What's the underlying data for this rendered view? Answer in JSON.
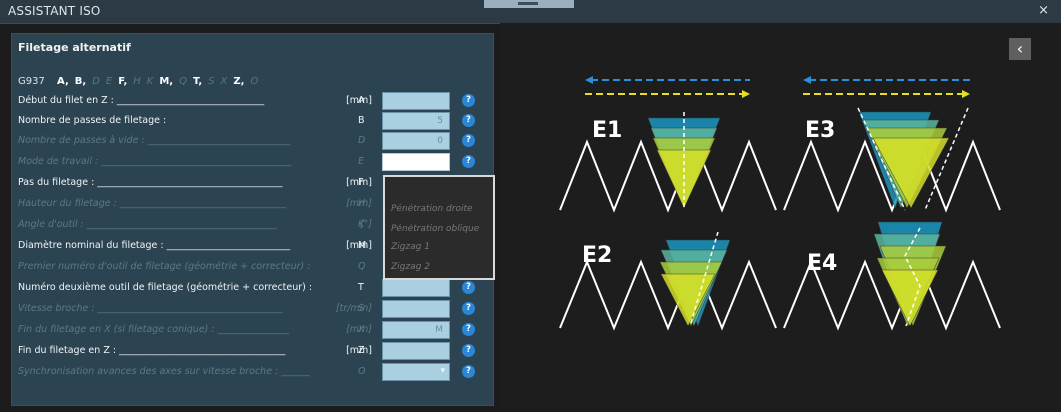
{
  "window": {
    "title": "ASSISTANT ISO",
    "close_icon": "×"
  },
  "panel": {
    "title": "Filetage alternatif",
    "gcode": {
      "prefix": "G937",
      "letters": [
        {
          "text": "A,",
          "active": true
        },
        {
          "text": "B,",
          "active": true
        },
        {
          "text": "D",
          "active": false
        },
        {
          "text": "E",
          "active": false
        },
        {
          "text": "F,",
          "active": true
        },
        {
          "text": "H",
          "active": false
        },
        {
          "text": "K",
          "active": false
        },
        {
          "text": "M,",
          "active": true
        },
        {
          "text": "Q",
          "active": false
        },
        {
          "text": "T,",
          "active": true
        },
        {
          "text": "S",
          "active": false
        },
        {
          "text": "X",
          "active": false
        },
        {
          "text": "Z,",
          "active": true
        },
        {
          "text": "O",
          "active": false
        }
      ]
    },
    "rows": [
      {
        "label": "Début du filet en Z : _______________________________",
        "unit": "[mm]",
        "letter": "A",
        "value": "",
        "active": true,
        "field": "blue"
      },
      {
        "label": "Nombre de passes de filetage :",
        "unit": "",
        "letter": "B",
        "value": "5",
        "active": true,
        "field": "blue"
      },
      {
        "label": "Nombre de passes à vide : ______________________________",
        "unit": "",
        "letter": "D",
        "value": "0",
        "active": false,
        "field": "blue"
      },
      {
        "label": "Mode de travail : ________________________________________",
        "unit": "",
        "letter": "E",
        "value": "",
        "active": false,
        "field": "white"
      },
      {
        "label": "Pas du filetage : _______________________________________",
        "unit": "[mm]",
        "letter": "F",
        "value": "",
        "active": true,
        "field": "none"
      },
      {
        "label": "Hauteur du filetage : ___________________________________",
        "unit": "[mm]",
        "letter": "H",
        "value": "",
        "active": false,
        "field": "none"
      },
      {
        "label": "Angle d'outil : ________________________________________",
        "unit": "[°]",
        "letter": "K",
        "value": "",
        "active": false,
        "field": "none"
      },
      {
        "label": "Diamètre nominal du filetage : __________________________",
        "unit": "[mm]",
        "letter": "M",
        "value": "",
        "active": true,
        "field": "none"
      },
      {
        "label": "Premier numéro d'outil de filetage (géométrie + correcteur) :",
        "unit": "",
        "letter": "Q",
        "value": "",
        "active": false,
        "field": "none"
      },
      {
        "label": "Numéro deuxième outil de filetage (géométrie + correcteur) :",
        "unit": "",
        "letter": "T",
        "value": "",
        "active": true,
        "field": "blue"
      },
      {
        "label": "Vitesse broche : _______________________________________",
        "unit": "[tr/min]",
        "letter": "S",
        "value": "",
        "active": false,
        "field": "blue"
      },
      {
        "label": "Fin du filetage en X (si filetage conique) : _______________",
        "unit": "[mm]",
        "letter": "X",
        "value": "M",
        "active": false,
        "field": "blue"
      },
      {
        "label": "Fin du filetage en Z : ___________________________________",
        "unit": "[mm]",
        "letter": "Z",
        "value": "",
        "active": true,
        "field": "blue"
      },
      {
        "label": "Synchronisation avances des axes sur vitesse broche : ______",
        "unit": "",
        "letter": "O",
        "value": "",
        "active": false,
        "field": "dropdown"
      }
    ],
    "help_icon": "?"
  },
  "popup": {
    "options": [
      "Pénétration droite",
      "Pénétration oblique",
      "Zigzag 1",
      "Zigzag 2"
    ]
  },
  "viz": {
    "back_icon": "‹",
    "diagrams": [
      "E1",
      "E3",
      "E2",
      "E4"
    ],
    "colors": {
      "blue_arrow": "#2a8fd6",
      "yellow_arrow": "#e6e020",
      "layer_top": "#1a98c2",
      "layer_mid": "#5bb5a0",
      "layer_low": "#a9cc3a",
      "layer_base": "#d4df28"
    }
  }
}
